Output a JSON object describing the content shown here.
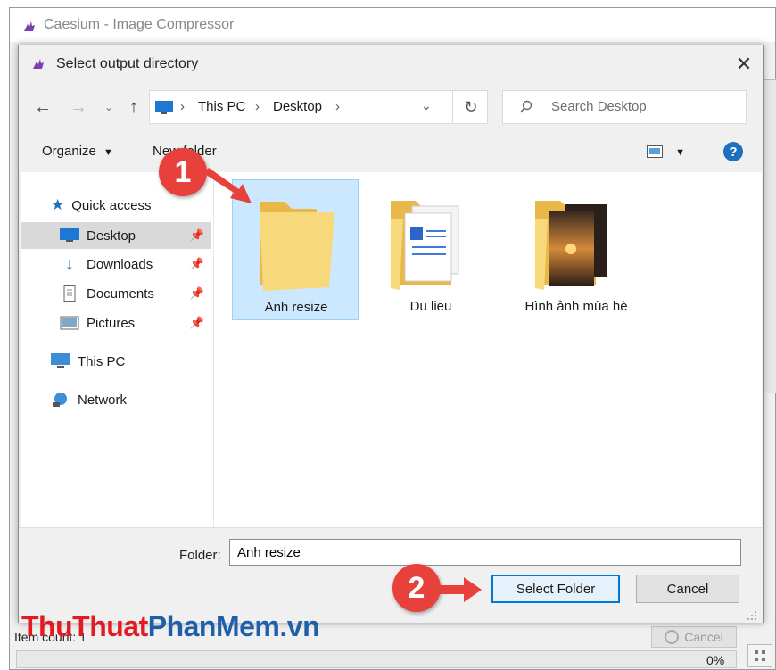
{
  "background_app": {
    "title": "Caesium - Image Compressor",
    "status_text": "Item count: 1",
    "cancel_label": "Cancel",
    "progress_value": 0,
    "progress_text": "0%"
  },
  "dialog": {
    "title": "Select output directory",
    "breadcrumb": [
      "This PC",
      "Desktop"
    ],
    "search_placeholder": "Search Desktop",
    "toolbar": {
      "organize_label": "Organize",
      "new_folder_label": "New folder"
    },
    "nav": {
      "quick_access": "Quick access",
      "items": [
        {
          "label": "Desktop",
          "pinned": true,
          "selected": true
        },
        {
          "label": "Downloads",
          "pinned": true
        },
        {
          "label": "Documents",
          "pinned": true
        },
        {
          "label": "Pictures",
          "pinned": true
        }
      ],
      "this_pc": "This PC",
      "network": "Network"
    },
    "files": [
      {
        "name": "Anh resize",
        "selected": true
      },
      {
        "name": "Du lieu"
      },
      {
        "name": "Hình ảnh mùa hè"
      }
    ],
    "folder_label": "Folder:",
    "folder_value": "Anh resize",
    "select_folder_label": "Select Folder",
    "cancel_label": "Cancel"
  },
  "annotations": {
    "step1": "1",
    "step2": "2"
  },
  "watermark": {
    "part1": "ThuThuat",
    "part2": "PhanMem",
    "part3": ".vn"
  },
  "colors": {
    "accent": "#0078d7",
    "badge": "#e8403a",
    "folder": "#f5d06f",
    "selected_bg": "#cce8ff"
  }
}
